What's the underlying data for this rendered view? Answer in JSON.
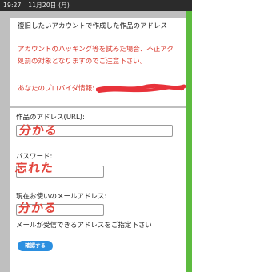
{
  "status": {
    "time": "19:27",
    "date": "11月20日 (月)"
  },
  "notice": {
    "line1": "復旧したいアカウントで作成した作品のアドレス",
    "warning_line1": "アカウントのハッキング等を試みた場合、不正アク",
    "warning_line2": "処罰の対象となりますのでご注意下さい。",
    "provider_label": "あなたのプロバイダ情報:"
  },
  "form": {
    "url_label": "作品のアドレス(URL):",
    "url_value": "分かる",
    "password_label": "パスワード:",
    "password_value": "忘れた",
    "email_label": "現在お使いのメールアドレス:",
    "email_value": "分かる",
    "email_note": "メールが受信できるアドレスをご指定下さい",
    "confirm_label": "確認する"
  },
  "colors": {
    "accent": "#2b8fe0",
    "warning": "#d8352a",
    "handwriting": "#e2453d",
    "side_bar": "#5dbb3f"
  }
}
